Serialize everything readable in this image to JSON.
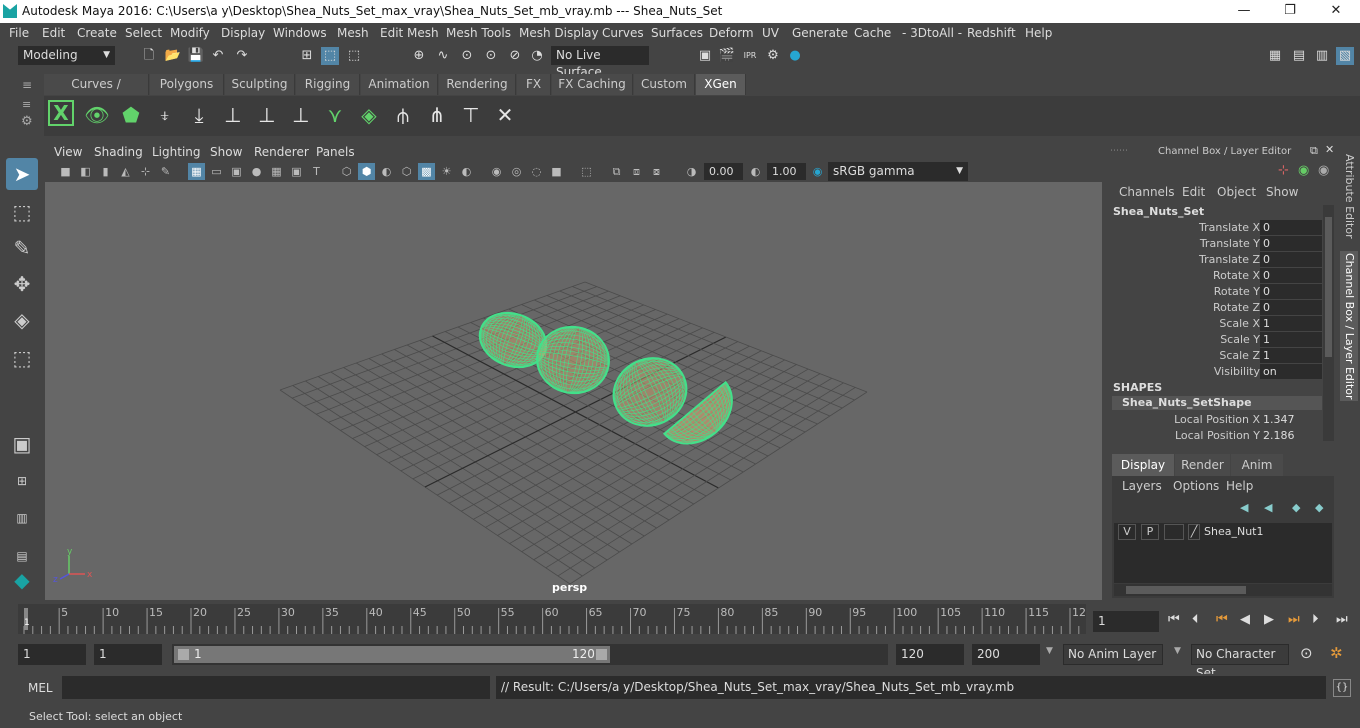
{
  "window": {
    "title": "Autodesk Maya 2016: C:\\Users\\a y\\Desktop\\Shea_Nuts_Set_max_vray\\Shea_Nuts_Set_mb_vray.mb   ---   Shea_Nuts_Set",
    "minimize": "—",
    "maximize": "❐",
    "close": "✕"
  },
  "menubar": [
    "File",
    "Edit",
    "Create",
    "Select",
    "Modify",
    "Display",
    "Windows",
    "Mesh",
    "Edit Mesh",
    "Mesh Tools",
    "Mesh Display",
    "Curves",
    "Surfaces",
    "Deform",
    "UV",
    "Generate",
    "Cache",
    "- 3DtoAll -",
    "Redshift",
    "Help"
  ],
  "statusline": {
    "mode": "Modeling",
    "live_surface": "No Live Surface"
  },
  "shelf_tabs": [
    "Curves / Surfaces",
    "Polygons",
    "Sculpting",
    "Rigging",
    "Animation",
    "Rendering",
    "FX",
    "FX Caching",
    "Custom",
    "XGen"
  ],
  "active_shelf_tab": "XGen",
  "viewport": {
    "menu": [
      "View",
      "Shading",
      "Lighting",
      "Show",
      "Renderer",
      "Panels"
    ],
    "exposure": "0.00",
    "gamma": "1.00",
    "color_space": "sRGB gamma",
    "camera_label": "persp",
    "mesh_color": "#43e08a",
    "axis_x": "x",
    "axis_y": "y",
    "axis_z": "z"
  },
  "channel_box": {
    "header": "Channel Box / Layer Editor",
    "menu": [
      "Channels",
      "Edit",
      "Object",
      "Show"
    ],
    "object_name": "Shea_Nuts_Set",
    "attributes": [
      {
        "label": "Translate X",
        "value": "0"
      },
      {
        "label": "Translate Y",
        "value": "0"
      },
      {
        "label": "Translate Z",
        "value": "0"
      },
      {
        "label": "Rotate X",
        "value": "0"
      },
      {
        "label": "Rotate Y",
        "value": "0"
      },
      {
        "label": "Rotate Z",
        "value": "0"
      },
      {
        "label": "Scale X",
        "value": "1"
      },
      {
        "label": "Scale Y",
        "value": "1"
      },
      {
        "label": "Scale Z",
        "value": "1"
      },
      {
        "label": "Visibility",
        "value": "on"
      }
    ],
    "shapes_header": "SHAPES",
    "shape_name": "Shea_Nuts_SetShape",
    "shape_attributes": [
      {
        "label": "Local Position X",
        "value": "1.347"
      },
      {
        "label": "Local Position Y",
        "value": "2.186"
      }
    ]
  },
  "layer_editor": {
    "tabs": [
      "Display",
      "Render",
      "Anim"
    ],
    "active_tab": "Display",
    "menu": [
      "Layers",
      "Options",
      "Help"
    ],
    "layers": [
      {
        "v": "V",
        "p": "P",
        "name": "Shea_Nut1"
      }
    ]
  },
  "side_tabs": [
    "Attribute Editor",
    "Channel Box / Layer Editor"
  ],
  "timeline": {
    "ticks": [
      "5",
      "10",
      "15",
      "20",
      "25",
      "30",
      "35",
      "40",
      "45",
      "50",
      "55",
      "60",
      "65",
      "70",
      "75",
      "80",
      "85",
      "90",
      "95",
      "100",
      "105",
      "110",
      "115",
      "12"
    ],
    "current_frame_marker": "1",
    "current_frame": "1"
  },
  "range": {
    "start": "1",
    "playback_start": "1",
    "slider_start": "1",
    "slider_end": "120",
    "playback_end": "120",
    "end": "200",
    "anim_layer": "No Anim Layer",
    "character_set": "No Character Set"
  },
  "command_line": {
    "label": "MEL",
    "input": "",
    "result": "// Result: C:/Users/a y/Desktop/Shea_Nuts_Set_max_vray/Shea_Nuts_Set_mb_vray.mb"
  },
  "help_line": "Select Tool: select an object"
}
